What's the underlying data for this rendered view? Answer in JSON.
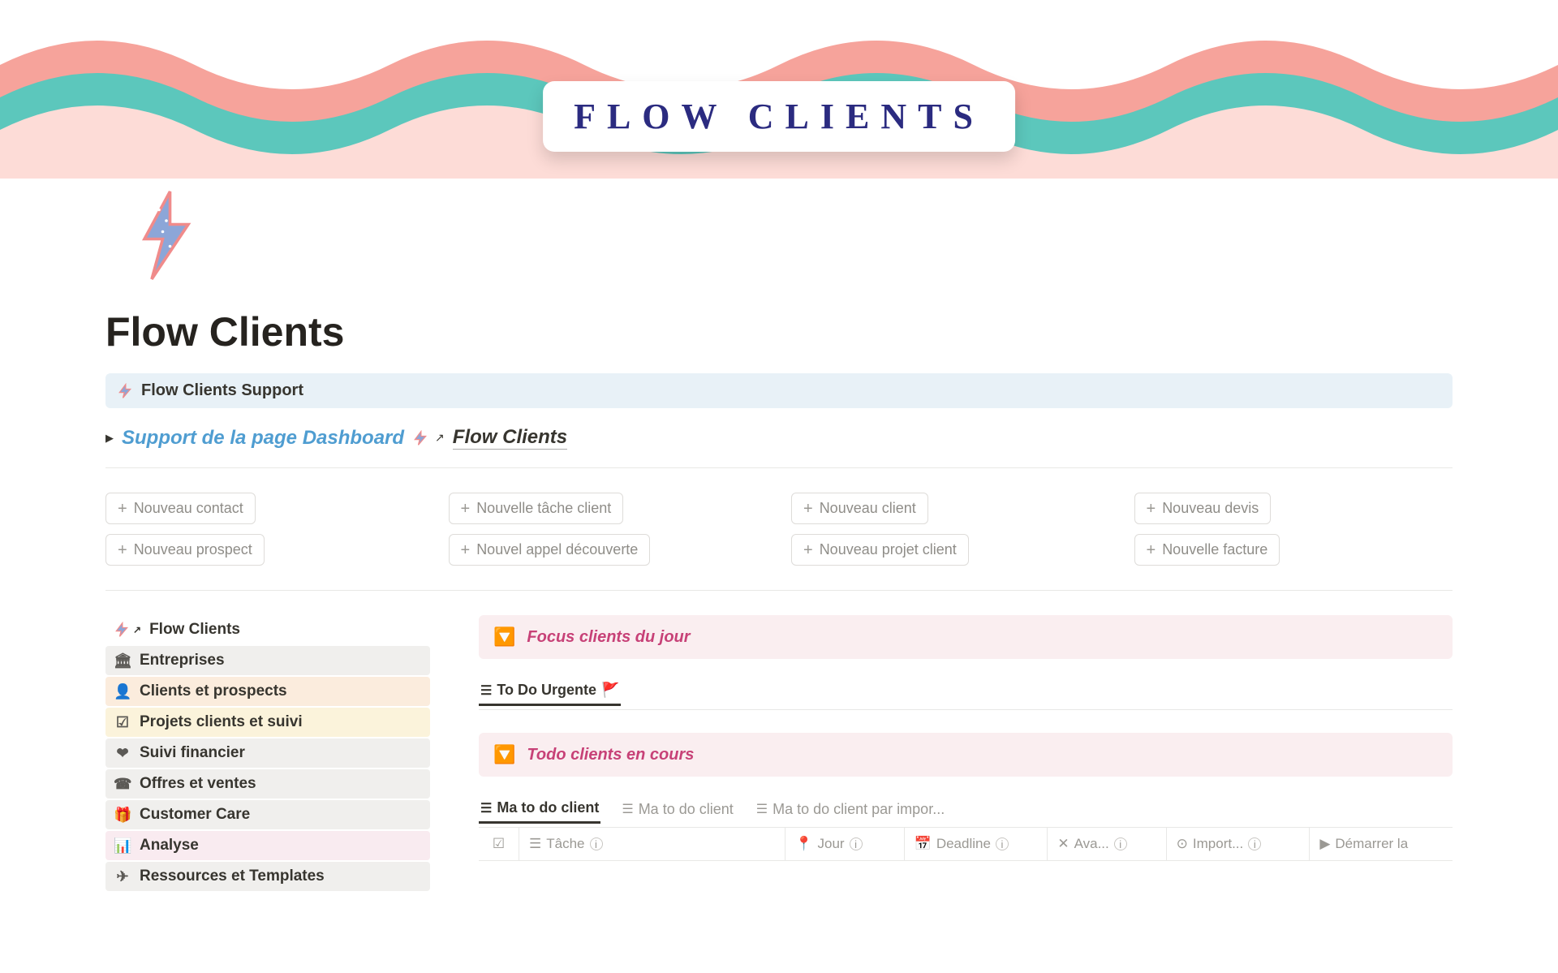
{
  "header": {
    "badge": "FLOW CLIENTS"
  },
  "page": {
    "title": "Flow Clients"
  },
  "support_callout": {
    "text": "Flow Clients Support"
  },
  "toggle": {
    "link": "Support de la page Dashboard",
    "sub": "Flow Clients"
  },
  "buttons": {
    "col1": [
      "Nouveau contact",
      "Nouveau prospect"
    ],
    "col2": [
      "Nouvelle tâche client",
      "Nouvel appel découverte"
    ],
    "col3": [
      "Nouveau client",
      "Nouveau projet client"
    ],
    "col4": [
      "Nouveau devis",
      "Nouvelle facture"
    ]
  },
  "sidebar": {
    "items": [
      {
        "icon": "bolt",
        "label": "Flow Clients",
        "cls": "bold"
      },
      {
        "icon": "🏛",
        "label": "Entreprises",
        "cls": "grey"
      },
      {
        "icon": "👤",
        "label": "Clients et prospects",
        "cls": "orange"
      },
      {
        "icon": "list",
        "label": "Projets clients et suivi",
        "cls": "yellow"
      },
      {
        "icon": "💔",
        "label": "Suivi financier",
        "cls": "grey"
      },
      {
        "icon": "📞",
        "label": "Offres et ventes",
        "cls": "grey"
      },
      {
        "icon": "🎁",
        "label": "Customer Care",
        "cls": "grey"
      },
      {
        "icon": "📊",
        "label": "Analyse",
        "cls": "pink"
      },
      {
        "icon": "✈",
        "label": "Ressources et Templates",
        "cls": "grey"
      }
    ]
  },
  "callouts": {
    "focus": "Focus clients du jour",
    "todo": "Todo clients en cours"
  },
  "urgent_tab": "To Do Urgente",
  "todo_tabs": [
    "Ma to do client",
    "Ma to do client",
    "Ma to do client par impor..."
  ],
  "table": {
    "cols": [
      "Tâche",
      "Jour",
      "Deadline",
      "Ava...",
      "Import...",
      "Démarrer la"
    ]
  }
}
